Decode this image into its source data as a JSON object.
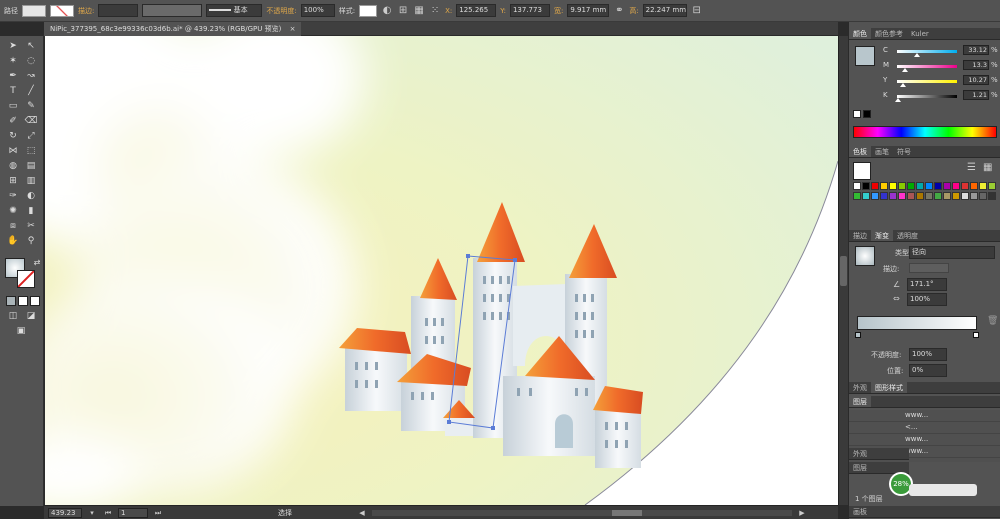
{
  "control_bar": {
    "object_type": "路径",
    "stroke_label": "描边:",
    "profile_label": "基本",
    "opacity_label": "不透明度:",
    "opacity_value": "100%",
    "style_label": "样式:",
    "x_label": "X:",
    "x_value": "125.265",
    "y_label": "Y:",
    "y_value": "137.773",
    "w_label": "宽:",
    "w_value": "9.917 mm",
    "h_label": "高:",
    "h_value": "22.247 mm"
  },
  "document": {
    "tab_title": "NiPic_377395_68c3e99336c03d6b.ai* @ 439.23% (RGB/GPU 预览)",
    "close_glyph": "×"
  },
  "status_bar": {
    "zoom": "439.23",
    "artboard": "1",
    "tool": "选择"
  },
  "color_panel": {
    "tabs": [
      "颜色",
      "颜色参考",
      "Kuler"
    ],
    "channels": [
      {
        "label": "C",
        "value": "33.12",
        "pos": 0.33
      },
      {
        "label": "M",
        "value": "13.3",
        "pos": 0.13
      },
      {
        "label": "Y",
        "value": "10.27",
        "pos": 0.1
      },
      {
        "label": "K",
        "value": "1.21",
        "pos": 0.01
      }
    ],
    "percent": "%"
  },
  "swatches_panel": {
    "tabs": [
      "色板",
      "画笔",
      "符号"
    ]
  },
  "gradient_panel": {
    "tabs": [
      "描边",
      "渐变",
      "透明度"
    ],
    "type_label": "类型:",
    "type_value": "径向",
    "stroke_label": "描边:",
    "angle_value": "171.1°",
    "ratio_value": "100%",
    "opacity_label": "不透明度:",
    "opacity_value": "100%",
    "location_label": "位置:",
    "location_value": "0%"
  },
  "appearance_panel": {
    "tabs": [
      "外观",
      "图形样式"
    ]
  },
  "layers_panel": {
    "tab": "图层",
    "rows": [
      {
        "name": "www..."
      },
      {
        "name": "<..."
      },
      {
        "name": "www..."
      },
      {
        "name": "www..."
      }
    ],
    "tab2": "外观",
    "tab3": "图层",
    "footer_count": "1 个图层",
    "bottom_tab": "画板"
  },
  "colors": {
    "accent": "#e0a84a",
    "roof": "#e8572a",
    "sky_yellow": "#f3f3b4",
    "sky_green": "#e9f5d6",
    "wall": "#f2f5f7"
  }
}
